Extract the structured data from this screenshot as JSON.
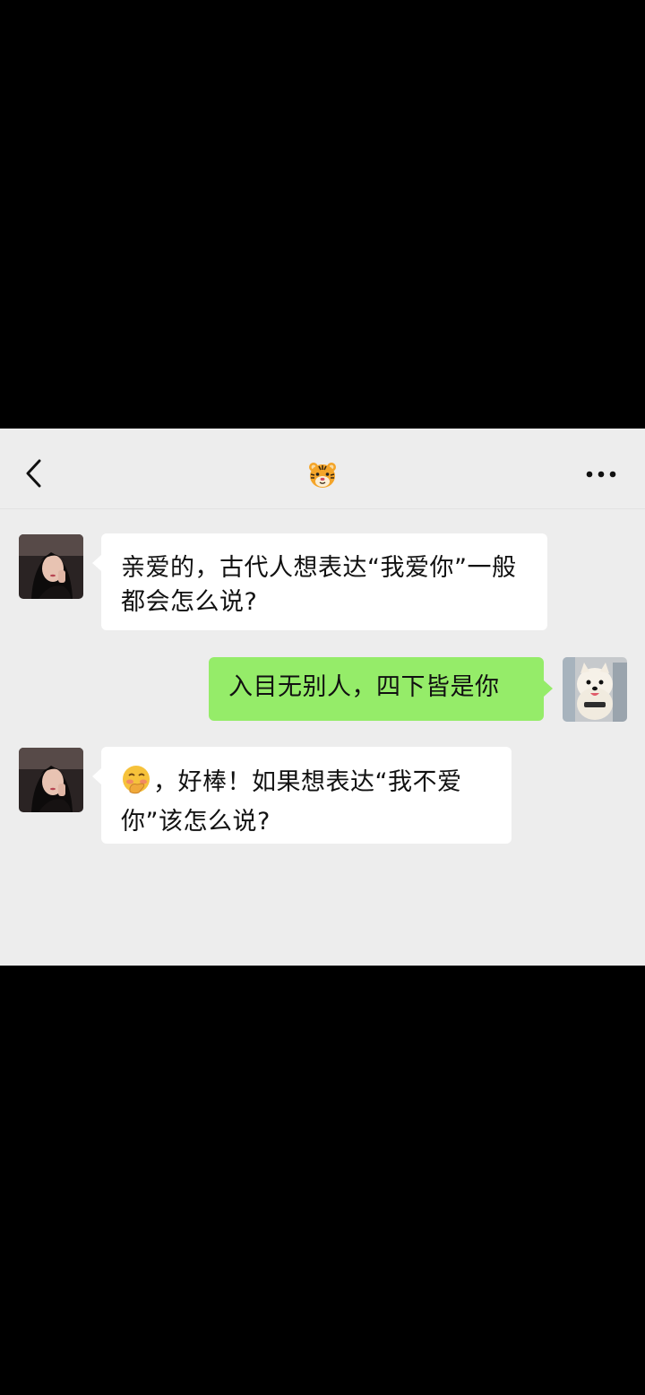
{
  "nav": {
    "back_icon": "chevron-left-icon",
    "title_emoji": "tiger-face-emoji",
    "more_icon": "more-dots-icon"
  },
  "messages": [
    {
      "side": "incoming",
      "avatar": "girl-avatar",
      "text": "亲爱的，古代人想表达“我爱你”一般都会怎么说?"
    },
    {
      "side": "outgoing",
      "avatar": "dog-avatar",
      "text": "入目无别人，四下皆是你"
    },
    {
      "side": "incoming",
      "avatar": "girl-avatar",
      "emoji": "blushing-hand-over-mouth-emoji",
      "text": "，好棒！如果想表达“我不爱你”该怎么说?"
    }
  ],
  "colors": {
    "background": "#ededed",
    "incoming_bubble": "#ffffff",
    "outgoing_bubble": "#95ec69",
    "outer": "#000000"
  }
}
